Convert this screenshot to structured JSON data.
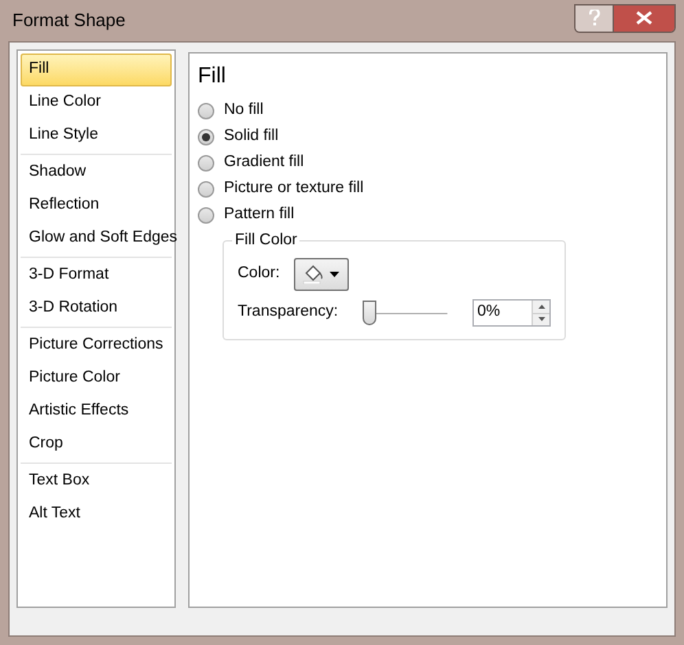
{
  "window": {
    "title": "Format Shape"
  },
  "sidebar": {
    "groups": [
      [
        {
          "label": "Fill",
          "selected": true
        },
        {
          "label": "Line Color",
          "selected": false
        },
        {
          "label": "Line Style",
          "selected": false
        }
      ],
      [
        {
          "label": "Shadow",
          "selected": false
        },
        {
          "label": "Reflection",
          "selected": false
        },
        {
          "label": "Glow and Soft Edges",
          "selected": false
        }
      ],
      [
        {
          "label": "3-D Format",
          "selected": false
        },
        {
          "label": "3-D Rotation",
          "selected": false
        }
      ],
      [
        {
          "label": "Picture Corrections",
          "selected": false
        },
        {
          "label": "Picture Color",
          "selected": false
        },
        {
          "label": "Artistic Effects",
          "selected": false
        },
        {
          "label": "Crop",
          "selected": false
        }
      ],
      [
        {
          "label": "Text Box",
          "selected": false
        },
        {
          "label": "Alt Text",
          "selected": false
        }
      ]
    ]
  },
  "panel": {
    "heading": "Fill",
    "options": [
      {
        "label": "No fill",
        "selected": false
      },
      {
        "label": "Solid fill",
        "selected": true
      },
      {
        "label": "Gradient fill",
        "selected": false
      },
      {
        "label": "Picture or texture fill",
        "selected": false
      },
      {
        "label": "Pattern fill",
        "selected": false
      }
    ],
    "fill_color": {
      "legend": "Fill Color",
      "color_label": "Color:",
      "transparency_label": "Transparency:",
      "transparency": {
        "level": 0
      },
      "transparency_value": "0%"
    }
  }
}
